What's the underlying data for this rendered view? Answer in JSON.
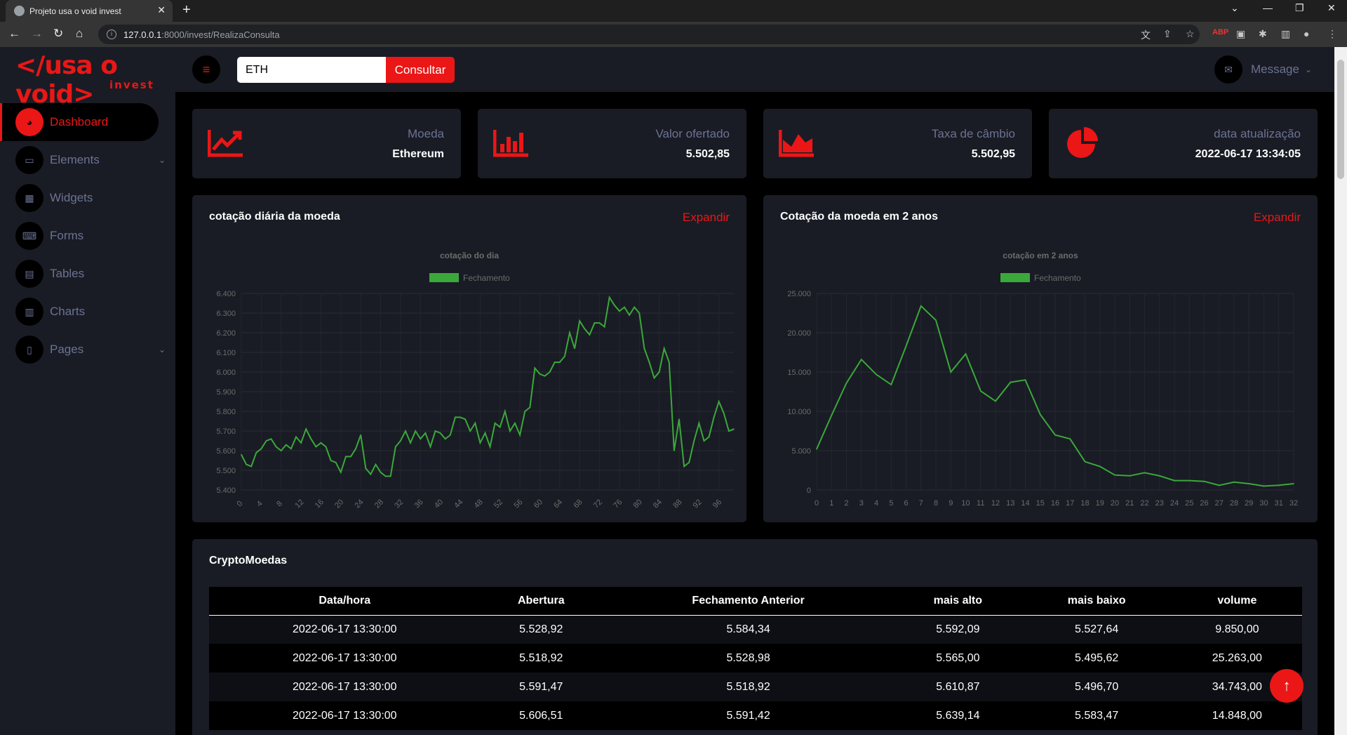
{
  "browser": {
    "tab_title": "Projeto usa o void invest",
    "url_host": "127.0.0.1",
    "url_path": ":8000/invest/RealizaConsulta"
  },
  "brand": {
    "title": "</usa o void>",
    "subtitle": "invest"
  },
  "sidebar": {
    "items": [
      {
        "label": "Dashboard",
        "icon": "dashboard-icon",
        "active": true
      },
      {
        "label": "Elements",
        "icon": "laptop-icon",
        "caret": true
      },
      {
        "label": "Widgets",
        "icon": "grid-icon"
      },
      {
        "label": "Forms",
        "icon": "keyboard-icon"
      },
      {
        "label": "Tables",
        "icon": "table-icon"
      },
      {
        "label": "Charts",
        "icon": "chart-icon"
      },
      {
        "label": "Pages",
        "icon": "file-icon",
        "caret": true
      }
    ]
  },
  "topbar": {
    "search_value": "ETH",
    "consult_label": "Consultar",
    "message_label": "Message"
  },
  "stats": [
    {
      "label": "Moeda",
      "value": "Ethereum",
      "icon": "line-chart-icon"
    },
    {
      "label": "Valor ofertado",
      "value": "5.502,85",
      "icon": "bar-chart-icon"
    },
    {
      "label": "Taxa de câmbio",
      "value": "5.502,95",
      "icon": "area-chart-icon"
    },
    {
      "label": "data atualização",
      "value": "2022-06-17 13:34:05",
      "icon": "pie-chart-icon"
    }
  ],
  "charts": {
    "expand_label": "Expandir",
    "accent": "#eb1616",
    "line_color": "#3ba83b"
  },
  "chart_data": [
    {
      "type": "line",
      "card_title": "cotação diária da moeda",
      "title": "cotação do dia",
      "series": [
        {
          "name": "Fechamento",
          "values": [
            5580,
            5530,
            5520,
            5590,
            5610,
            5650,
            5660,
            5620,
            5600,
            5630,
            5610,
            5670,
            5640,
            5710,
            5660,
            5620,
            5640,
            5620,
            5550,
            5540,
            5490,
            5570,
            5570,
            5610,
            5680,
            5510,
            5480,
            5530,
            5490,
            5470,
            5470,
            5620,
            5650,
            5700,
            5640,
            5700,
            5660,
            5690,
            5620,
            5700,
            5690,
            5660,
            5680,
            5770,
            5770,
            5760,
            5700,
            5740,
            5640,
            5690,
            5620,
            5740,
            5720,
            5800,
            5700,
            5740,
            5680,
            5800,
            5820,
            6020,
            5990,
            5980,
            6000,
            6050,
            6050,
            6080,
            6200,
            6120,
            6260,
            6220,
            6190,
            6250,
            6250,
            6230,
            6380,
            6340,
            6310,
            6330,
            6290,
            6330,
            6300,
            6120,
            6050,
            5970,
            6000,
            6120,
            6050,
            5600,
            5760,
            5520,
            5540,
            5650,
            5740,
            5650,
            5670,
            5770,
            5850,
            5790,
            5700,
            5710
          ]
        }
      ],
      "x": [
        0,
        4,
        8,
        12,
        16,
        20,
        24,
        28,
        32,
        36,
        40,
        44,
        48,
        52,
        56,
        60,
        64,
        68,
        72,
        76,
        80,
        84,
        88,
        92,
        96
      ],
      "yticks": [
        "6.400",
        "6.300",
        "6.200",
        "6.100",
        "6.000",
        "5.900",
        "5.800",
        "5.700",
        "5.600",
        "5.500",
        "5.400"
      ],
      "ylim": [
        5400,
        6400
      ]
    },
    {
      "type": "line",
      "card_title": "Cotação da moeda em 2 anos",
      "title": "cotação em 2 anos",
      "series": [
        {
          "name": "Fechamento",
          "values": [
            5200,
            9500,
            13600,
            16600,
            14700,
            13400,
            18300,
            23400,
            21600,
            15000,
            17300,
            12600,
            11300,
            13700,
            14000,
            9600,
            7000,
            6500,
            3600,
            3000,
            1900,
            1800,
            2200,
            1800,
            1200,
            1200,
            1100,
            600,
            1000,
            800,
            500,
            600,
            800
          ]
        }
      ],
      "x": [
        0,
        1,
        2,
        3,
        4,
        5,
        6,
        7,
        8,
        9,
        10,
        11,
        12,
        13,
        14,
        15,
        16,
        17,
        18,
        19,
        20,
        21,
        22,
        23,
        24,
        25,
        26,
        27,
        28,
        29,
        30,
        31,
        32
      ],
      "yticks": [
        "25.000",
        "20.000",
        "15.000",
        "10.000",
        "5.000",
        "0"
      ],
      "ylim": [
        0,
        25000
      ]
    }
  ],
  "table": {
    "title": "CryptoMoedas",
    "columns": [
      "Data/hora",
      "Abertura",
      "Fechamento Anterior",
      "mais alto",
      "mais baixo",
      "volume"
    ],
    "rows": [
      [
        "2022-06-17 13:30:00",
        "5.528,92",
        "5.584,34",
        "5.592,09",
        "5.527,64",
        "9.850,00"
      ],
      [
        "2022-06-17 13:30:00",
        "5.518,92",
        "5.528,98",
        "5.565,00",
        "5.495,62",
        "25.263,00"
      ],
      [
        "2022-06-17 13:30:00",
        "5.591,47",
        "5.518,92",
        "5.610,87",
        "5.496,70",
        "34.743,00"
      ],
      [
        "2022-06-17 13:30:00",
        "5.606,51",
        "5.591,42",
        "5.639,14",
        "5.583,47",
        "14.848,00"
      ]
    ]
  }
}
